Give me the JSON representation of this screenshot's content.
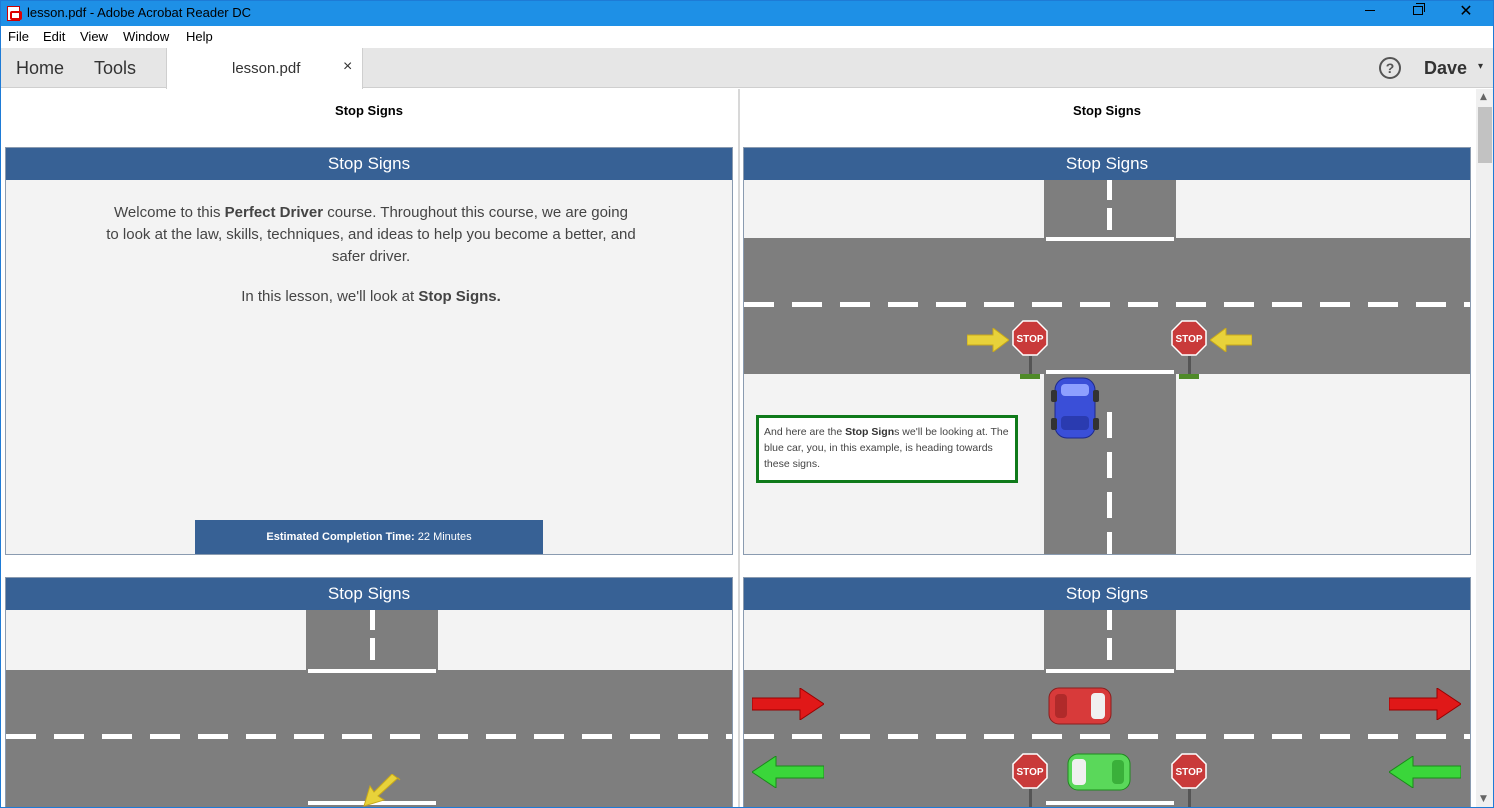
{
  "window": {
    "title": "lesson.pdf - Adobe Acrobat Reader DC",
    "minimize": "–",
    "close": "✕"
  },
  "menu": [
    "File",
    "Edit",
    "View",
    "Window",
    "Help"
  ],
  "tabs": {
    "home": "Home",
    "tools": "Tools",
    "document": "lesson.pdf",
    "close": "×",
    "help": "?",
    "user": "Dave",
    "user_chevron": "▾"
  },
  "pages": {
    "left_header": "Stop Signs",
    "right_header": "Stop Signs"
  },
  "slides": {
    "slide1": {
      "title": "Stop Signs",
      "intro_pre": "Welcome to this ",
      "intro_bold": "Perfect Driver",
      "intro_post": " course. Throughout this course, we are going to look at the law, skills, techniques, and ideas to help you become a better, and safer driver.",
      "lesson_pre": "In this lesson, we'll look at ",
      "lesson_bold": "Stop Signs.",
      "completion_label": "Estimated Completion Time:",
      "completion_value": " 22 Minutes"
    },
    "slide2": {
      "title": "Stop Signs",
      "stop_text": "STOP",
      "callout_pre": "And here are the ",
      "callout_bold": "Stop Sign",
      "callout_post": "s we'll be looking at. The blue car, you, in this example, is heading towards these signs."
    },
    "slide3": {
      "title": "Stop Signs"
    },
    "slide4": {
      "title": "Stop Signs",
      "stop_text": "STOP"
    }
  },
  "colors": {
    "slide_header": "#376195",
    "road": "#7e7e7e",
    "callout_border": "#0f7a1a",
    "titlebar": "#1e90e6"
  }
}
